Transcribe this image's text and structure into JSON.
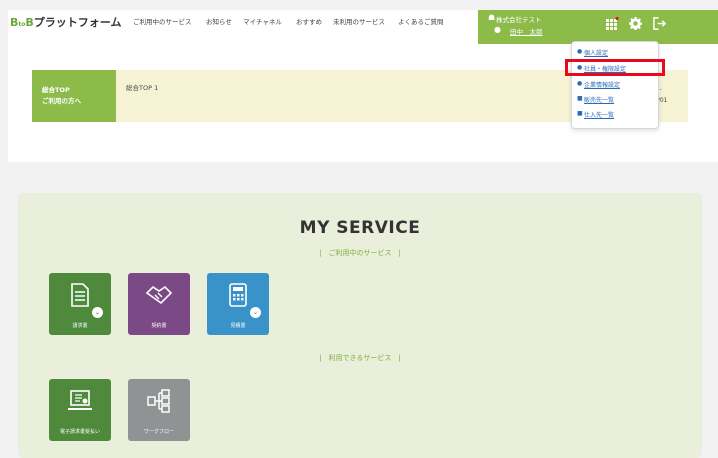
{
  "header": {
    "logo": {
      "b1": "B",
      "mid": "to",
      "b2": "B",
      "rest": "プラットフォーム"
    },
    "nav": [
      "ご利用中のサービス",
      "お知らせ",
      "マイチャネル",
      "おすすめ",
      "未利用のサービス",
      "よくあるご質問"
    ],
    "company": "株式会社テスト",
    "user": "田中　太郎"
  },
  "top": {
    "green_line1": "総合TOP",
    "green_line2": "ご利用の方へ",
    "news": "総合TOP 1",
    "side_line1": "e -",
    "side_line2": "1/01"
  },
  "dropdown": {
    "items": [
      "個人設定",
      "社員・権限設定",
      "企業情報設定",
      "販売先一覧",
      "仕入先一覧"
    ]
  },
  "service": {
    "title": "MY SERVICE",
    "in_use": "|　ご利用中のサービス　|",
    "available": "|　利用できるサービス　|",
    "tiles": [
      {
        "label": "請求書",
        "color": "#4f8a3c"
      },
      {
        "label": "契約書",
        "color": "#7b4a86"
      },
      {
        "label": "見積書",
        "color": "#3a93c8"
      },
      {
        "label": "電子請求書受払い",
        "color": "#4f8a3c"
      },
      {
        "label": "ワークフロー",
        "color": "#8f9394"
      }
    ]
  },
  "colors": {
    "brand_green": "#8dbb4a",
    "highlight": "#e8091e",
    "link": "#2b6cb8"
  }
}
